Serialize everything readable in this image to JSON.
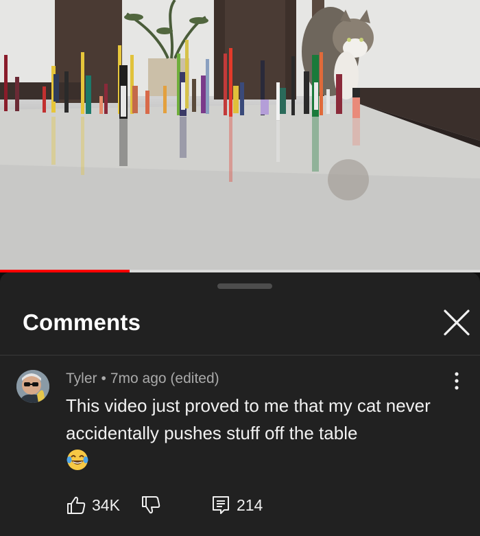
{
  "video": {
    "progress_percent": 27
  },
  "comments_panel": {
    "title": "Comments",
    "close_icon": "close-icon",
    "comment": {
      "author": "Tyler",
      "separator": "•",
      "time": "7mo ago (edited)",
      "text": "This video just proved to me that my cat never accidentally pushes stuff off the table",
      "emoji": "😂",
      "likes": "34K",
      "replies": "214",
      "icons": {
        "like": "thumbs-up-icon",
        "dislike": "thumbs-down-icon",
        "reply": "reply-icon",
        "more": "more-vertical-icon"
      }
    }
  },
  "colors": {
    "sheet_background": "#212121",
    "progress": "#ff0000",
    "secondary_text": "#aaaaaa"
  }
}
